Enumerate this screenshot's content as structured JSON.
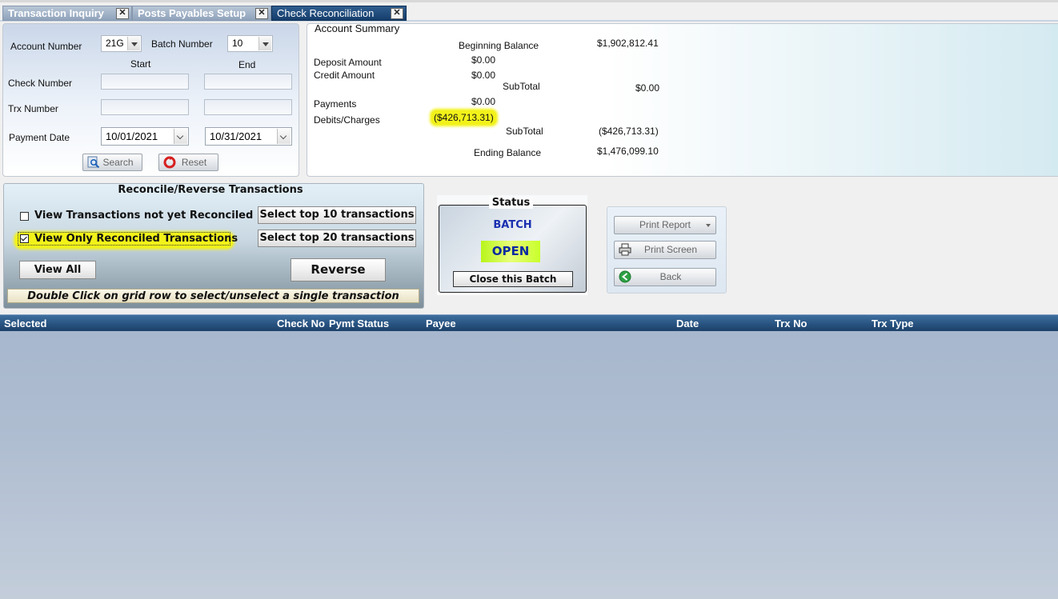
{
  "tabs": [
    {
      "label": "Transaction Inquiry",
      "active": false
    },
    {
      "label": "Posts Payables Setup",
      "active": false
    },
    {
      "label": "Check Reconciliation",
      "active": true
    }
  ],
  "search": {
    "account_number_label": "Account Number",
    "account_number_value": "21G",
    "batch_number_label": "Batch Number",
    "batch_number_value": "10",
    "start_label": "Start",
    "end_label": "End",
    "check_number_label": "Check Number",
    "check_number_start": "",
    "check_number_end": "",
    "trx_number_label": "Trx Number",
    "trx_number_start": "",
    "trx_number_end": "",
    "payment_date_label": "Payment Date",
    "payment_date_start": "10/01/2021",
    "payment_date_end": "10/31/2021",
    "search_button": "Search",
    "reset_button": "Reset"
  },
  "summary": {
    "title": "Account Summary",
    "beginning_balance_label": "Beginning Balance",
    "beginning_balance": "$1,902,812.41",
    "deposit_amount_label": "Deposit Amount",
    "deposit_amount": "$0.00",
    "credit_amount_label": "Credit Amount",
    "credit_amount": "$0.00",
    "subtotal1_label": "SubTotal",
    "subtotal1": "$0.00",
    "payments_label": "Payments",
    "payments": "$0.00",
    "debits_label": "Debits/Charges",
    "debits": "($426,713.31)",
    "subtotal2_label": "SubTotal",
    "subtotal2": "($426,713.31)",
    "ending_balance_label": "Ending Balance",
    "ending_balance": "$1,476,099.10"
  },
  "reconcile": {
    "title": "Reconcile/Reverse Transactions",
    "opt_not_reconciled": "View Transactions not yet Reconciled",
    "opt_not_reconciled_checked": false,
    "opt_reconciled_only": "View Only Reconciled Transactions",
    "opt_reconciled_only_checked": true,
    "select_top10": "Select top 10 transactions",
    "select_top20": "Select top 20 transactions",
    "view_all": "View All",
    "reverse": "Reverse",
    "hint": "Double Click on grid row to select/unselect a single transaction"
  },
  "status": {
    "title": "Status",
    "batch_label": "BATCH",
    "state": "OPEN",
    "close_batch": "Close this Batch"
  },
  "actions": {
    "print_report": "Print Report",
    "print_screen": "Print Screen",
    "back": "Back"
  },
  "grid": {
    "columns": [
      "Selected",
      "Check No",
      "Pymt Status",
      "Payee",
      "Date",
      "Trx No",
      "Trx Type"
    ],
    "rows": []
  },
  "colors": {
    "highlight": "#f2f21a",
    "open_status_bg": "#ccff33",
    "grid_header": "#26507d"
  }
}
